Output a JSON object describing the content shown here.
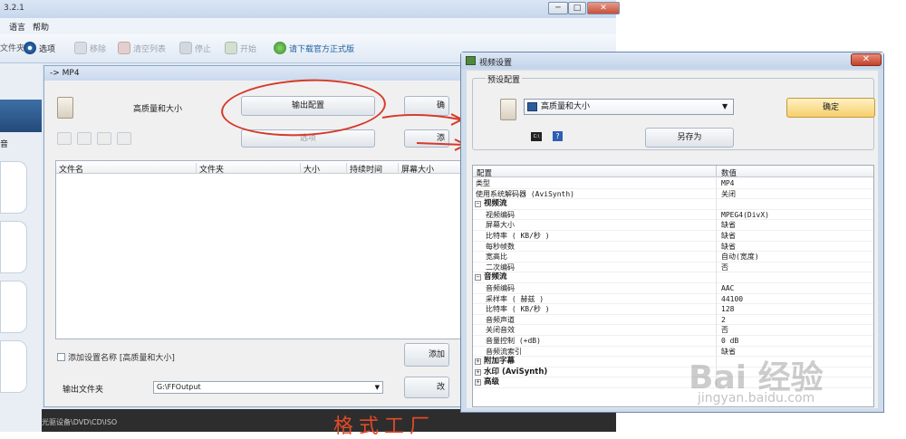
{
  "main_window": {
    "title": "3.2.1",
    "caption_buttons": [
      "─",
      "□",
      "✕"
    ],
    "menu": [
      "语言",
      "帮助"
    ],
    "toolbar": {
      "files_label": "文件夹",
      "options_label": "选项",
      "remove_label": "移除",
      "clear_list_label": "清空列表",
      "stop_label": "停止",
      "start_label": "开始",
      "download_label": "请下载官方正式版"
    },
    "left_tab_label": "音",
    "bottom_label": "光驱设备\\DVD\\CD\\ISO",
    "banner_text": "格式工厂"
  },
  "mp4_dialog": {
    "title": "-> MP4",
    "preset_label": "高质量和大小",
    "output_config_label": "输出配置",
    "options_label": "选项",
    "file_table": {
      "columns": [
        "文件名",
        "文件夹",
        "大小",
        "持续时间",
        "屏幕大小"
      ]
    },
    "add_setting_name_label": "添加设置名称 [高质量和大小]",
    "output_folder_label": "输出文件夹",
    "output_folder_value": "G:\\FFOutput",
    "right_btn_1_label": "确",
    "right_btn_2_label": "添",
    "right_btn_3_label": "添加",
    "right_btn_4_label": "改"
  },
  "video_dialog": {
    "title": "视频设置",
    "close_label": "✕",
    "preset_group_label": "预设配置",
    "preset_selected": "高质量和大小",
    "confirm_label": "确定",
    "saveas_label": "另存为",
    "cmd_icon_text": "C:\\",
    "help_icon_text": "?",
    "grid_header": {
      "name": "配置",
      "value": "数值"
    },
    "rows": [
      {
        "name": "类型",
        "value": "MP4",
        "indent": 0,
        "category": false
      },
      {
        "name": "使用系统解码器 (AviSynth)",
        "value": "关闭",
        "indent": 0,
        "category": false
      },
      {
        "name": "视频流",
        "value": "",
        "indent": 0,
        "category": true,
        "expander": "−"
      },
      {
        "name": "视频编码",
        "value": "MPEG4(DivX)",
        "indent": 1,
        "category": false
      },
      {
        "name": "屏幕大小",
        "value": "缺省",
        "indent": 1,
        "category": false
      },
      {
        "name": "比特率 ( KB/秒 )",
        "value": "缺省",
        "indent": 1,
        "category": false
      },
      {
        "name": "每秒帧数",
        "value": "缺省",
        "indent": 1,
        "category": false
      },
      {
        "name": "宽高比",
        "value": "自动(宽度)",
        "indent": 1,
        "category": false
      },
      {
        "name": "二次编码",
        "value": "否",
        "indent": 1,
        "category": false
      },
      {
        "name": "音频流",
        "value": "",
        "indent": 0,
        "category": true,
        "expander": "−"
      },
      {
        "name": "音频编码",
        "value": "AAC",
        "indent": 1,
        "category": false
      },
      {
        "name": "采样率 ( 赫兹 )",
        "value": "44100",
        "indent": 1,
        "category": false
      },
      {
        "name": "比特率 ( KB/秒 )",
        "value": "128",
        "indent": 1,
        "category": false
      },
      {
        "name": "音频声道",
        "value": "2",
        "indent": 1,
        "category": false
      },
      {
        "name": "关闭音效",
        "value": "否",
        "indent": 1,
        "category": false
      },
      {
        "name": "音量控制 (+dB)",
        "value": "0 dB",
        "indent": 1,
        "category": false
      },
      {
        "name": "音频流索引",
        "value": "缺省",
        "indent": 1,
        "category": false
      },
      {
        "name": "附加字幕",
        "value": "",
        "indent": 0,
        "category": true,
        "expander": "+"
      },
      {
        "name": "水印 (AviSynth)",
        "value": "",
        "indent": 0,
        "category": true,
        "expander": "+"
      },
      {
        "name": "高级",
        "value": "",
        "indent": 0,
        "category": true,
        "expander": "+"
      }
    ]
  },
  "watermark": {
    "text": "Bai 经验",
    "url": "jingyan.baidu.com"
  },
  "colors": {
    "annotation_red": "#d63a2a",
    "confirm_yellow": "#f6cf6a"
  }
}
